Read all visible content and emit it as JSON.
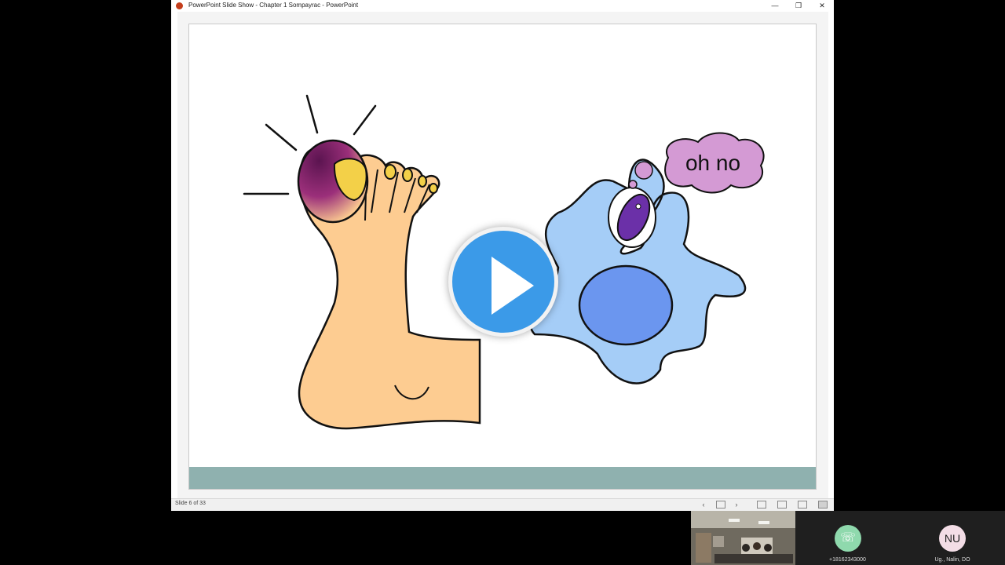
{
  "window": {
    "title": "PowerPoint Slide Show  -  Chapter 1 Sompayrac  -  PowerPoint",
    "minimize_glyph": "—",
    "restore_glyph": "❐",
    "close_glyph": "✕"
  },
  "slide": {
    "thought_text": "oh no"
  },
  "statusbar": {
    "slide_counter": "Slide 6 of 33",
    "prev_glyph": "‹",
    "next_glyph": "›"
  },
  "participants": [
    {
      "label": "",
      "kind": "room-video"
    },
    {
      "label": "+18162343000",
      "avatar_glyph": "☏"
    },
    {
      "label": "Ug., Nalin, DO",
      "initials": "NU"
    }
  ],
  "colors": {
    "footer_band": "#8fb1af",
    "play_button": "#3b9ae8",
    "cell": "#a5cdf7",
    "nucleus": "#6b96ef",
    "bacterium": "#6b30a8",
    "thought_bubble": "#d49ad4",
    "skin": "#fdcc91"
  }
}
